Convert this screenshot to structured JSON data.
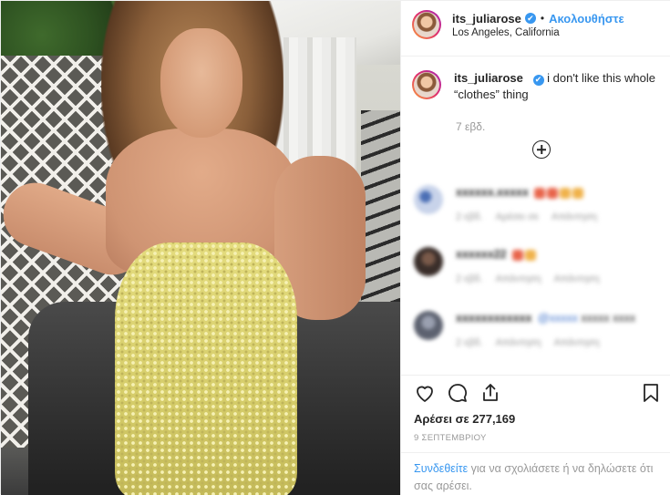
{
  "header": {
    "username": "its_juliarose",
    "verified_mark": "✔",
    "separator": "•",
    "follow_label": "Ακολουθήστε",
    "location": "Los Angeles, California"
  },
  "caption": {
    "username": "its_juliarose",
    "text": "i don't like this whole “clothes” thing",
    "age": "7 εβδ."
  },
  "comments": [
    {
      "username": "xxxxxx.xxxxx",
      "text": "",
      "meta": [
        "2 εβδ.",
        "Αρέσει σε",
        "Απάντηση"
      ]
    },
    {
      "username": "xxxxxx22",
      "text": "",
      "meta": [
        "2 εβδ.",
        "Απάντηση",
        "Απάντηση"
      ]
    },
    {
      "username": "xxxxxxxxxxxx",
      "link": "@xxxxx",
      "text": "xxxxx xxxx",
      "meta": [
        "2 εβδ.",
        "Απάντηση",
        "Απάντηση"
      ]
    }
  ],
  "stats": {
    "likes": "Αρέσει σε 277,169",
    "date": "9 ΣΕΠΤΕΜΒΡΙΟΥ"
  },
  "login": {
    "link_text": "Συνδεθείτε",
    "rest_text": " για να σχολιάσετε ή να δηλώσετε ότι σας αρέσει."
  },
  "icons": {
    "heart": "heart-icon",
    "comment": "comment-icon",
    "share": "share-icon",
    "save": "bookmark-icon",
    "load_more": "plus-circle-icon"
  },
  "colors": {
    "accent": "#3897f0",
    "text": "#262626",
    "muted": "#999999"
  }
}
